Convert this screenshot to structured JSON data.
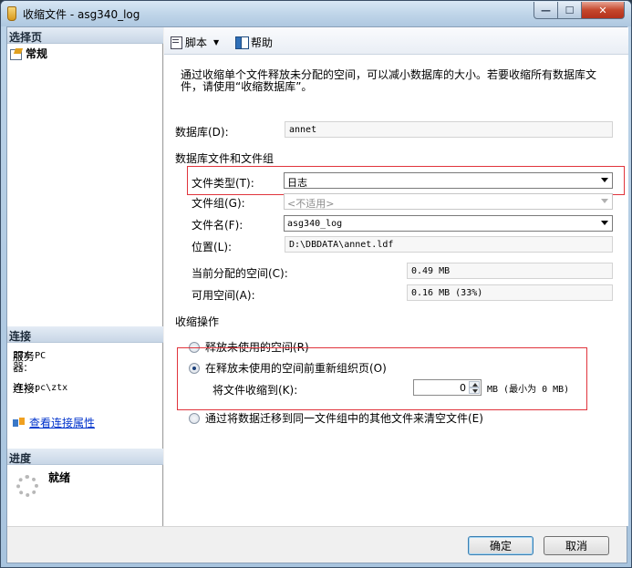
{
  "window": {
    "title": "收缩文件 - asg340_log",
    "minimize": "—",
    "maximize": "☐",
    "close": "✕"
  },
  "sidebar": {
    "select_page_header": "选择页",
    "pages": [
      {
        "label": "常规"
      }
    ],
    "connection_header": "连接",
    "server_label": "服务器:",
    "server_value": "ZTX-PC",
    "connection_label": "连接:",
    "connection_value": "ztx-pc\\ztx",
    "view_connection_link": "查看连接属性",
    "progress_header": "进度",
    "progress_status": "就绪"
  },
  "toolbar": {
    "script_label": "脚本",
    "help_label": "帮助"
  },
  "form": {
    "description": "通过收缩单个文件释放未分配的空间，可以减小数据库的大小。若要收缩所有数据库文件，请使用“收缩数据库”。",
    "database_label": "数据库(D):",
    "database_value": "annet",
    "files_group_title": "数据库文件和文件组",
    "file_type_label": "文件类型(T):",
    "file_type_value": "日志",
    "filegroup_label": "文件组(G):",
    "filegroup_value": "<不适用>",
    "filename_label": "文件名(F):",
    "filename_value": "asg340_log",
    "location_label": "位置(L):",
    "location_value": "D:\\DBDATA\\annet.ldf",
    "allocated_label": "当前分配的空间(C):",
    "allocated_value": "0.49 MB",
    "available_label": "可用空间(A):",
    "available_value": "0.16 MB (33%)",
    "shrink_action_title": "收缩操作",
    "option_release": "释放未使用的空间(R)",
    "option_reorganize": "在释放未使用的空间前重新组织页(O)",
    "shrink_to_label": "将文件收缩到(K):",
    "shrink_to_value": "0",
    "shrink_to_suffix": "MB (最小为 0 MB)",
    "option_empty": "通过将数据迁移到同一文件组中的其他文件来清空文件(E)"
  },
  "buttons": {
    "ok": "确定",
    "cancel": "取消"
  },
  "colors": {
    "highlight_box": "#e0343c",
    "link": "#0033cc"
  }
}
